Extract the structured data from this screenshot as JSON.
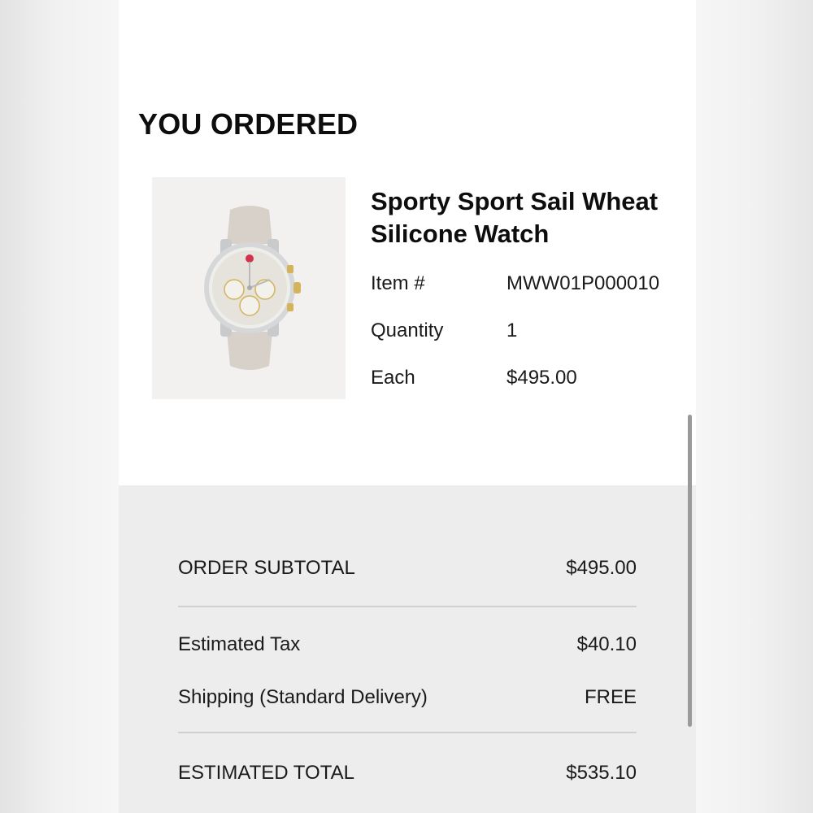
{
  "heading": "YOU ORDERED",
  "product": {
    "name": "Sporty Sport Sail Wheat Silicone Watch",
    "image_icon": "watch-product-photo",
    "details": {
      "item_label": "Item #",
      "item_value": "MWW01P000010",
      "quantity_label": "Quantity",
      "quantity_value": "1",
      "each_label": "Each",
      "each_value": "$495.00"
    }
  },
  "summary": {
    "subtotal_label": "ORDER SUBTOTAL",
    "subtotal_value": "$495.00",
    "tax_label": "Estimated Tax",
    "tax_value": "$40.10",
    "shipping_label": "Shipping (Standard Delivery)",
    "shipping_value": "FREE",
    "total_label": "ESTIMATED TOTAL",
    "total_value": "$535.10"
  },
  "colors": {
    "panel_bg": "#ffffff",
    "summary_bg": "#ededed",
    "strap": "#d8d1ca",
    "gold_accent": "#d4b35a"
  }
}
